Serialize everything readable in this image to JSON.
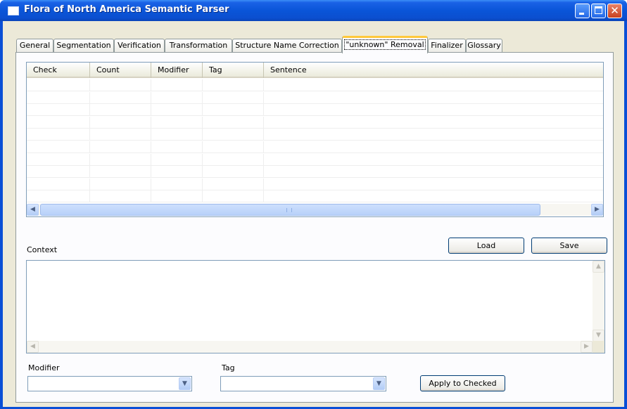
{
  "window": {
    "title": "Flora of North America Semantic Parser"
  },
  "tabs": [
    {
      "label": "General"
    },
    {
      "label": "Segmentation"
    },
    {
      "label": "Verification"
    },
    {
      "label": "Transformation"
    },
    {
      "label": "Structure Name Correction"
    },
    {
      "label": "\"unknown\" Removal",
      "active": true
    },
    {
      "label": "Finalizer"
    },
    {
      "label": "Glossary"
    }
  ],
  "table": {
    "columns": [
      "Check",
      "Count",
      "Modifier",
      "Tag",
      "Sentence"
    ],
    "rows": []
  },
  "context": {
    "label": "Context",
    "value": ""
  },
  "buttons": {
    "load": "Load",
    "save": "Save",
    "apply": "Apply to Checked"
  },
  "fields": {
    "modifier": {
      "label": "Modifier",
      "value": ""
    },
    "tag": {
      "label": "Tag",
      "value": ""
    }
  },
  "colors": {
    "title_bar": "#0a55d8",
    "client_bg": "#ece9d8",
    "active_tab_accent": "#ffc83c"
  }
}
